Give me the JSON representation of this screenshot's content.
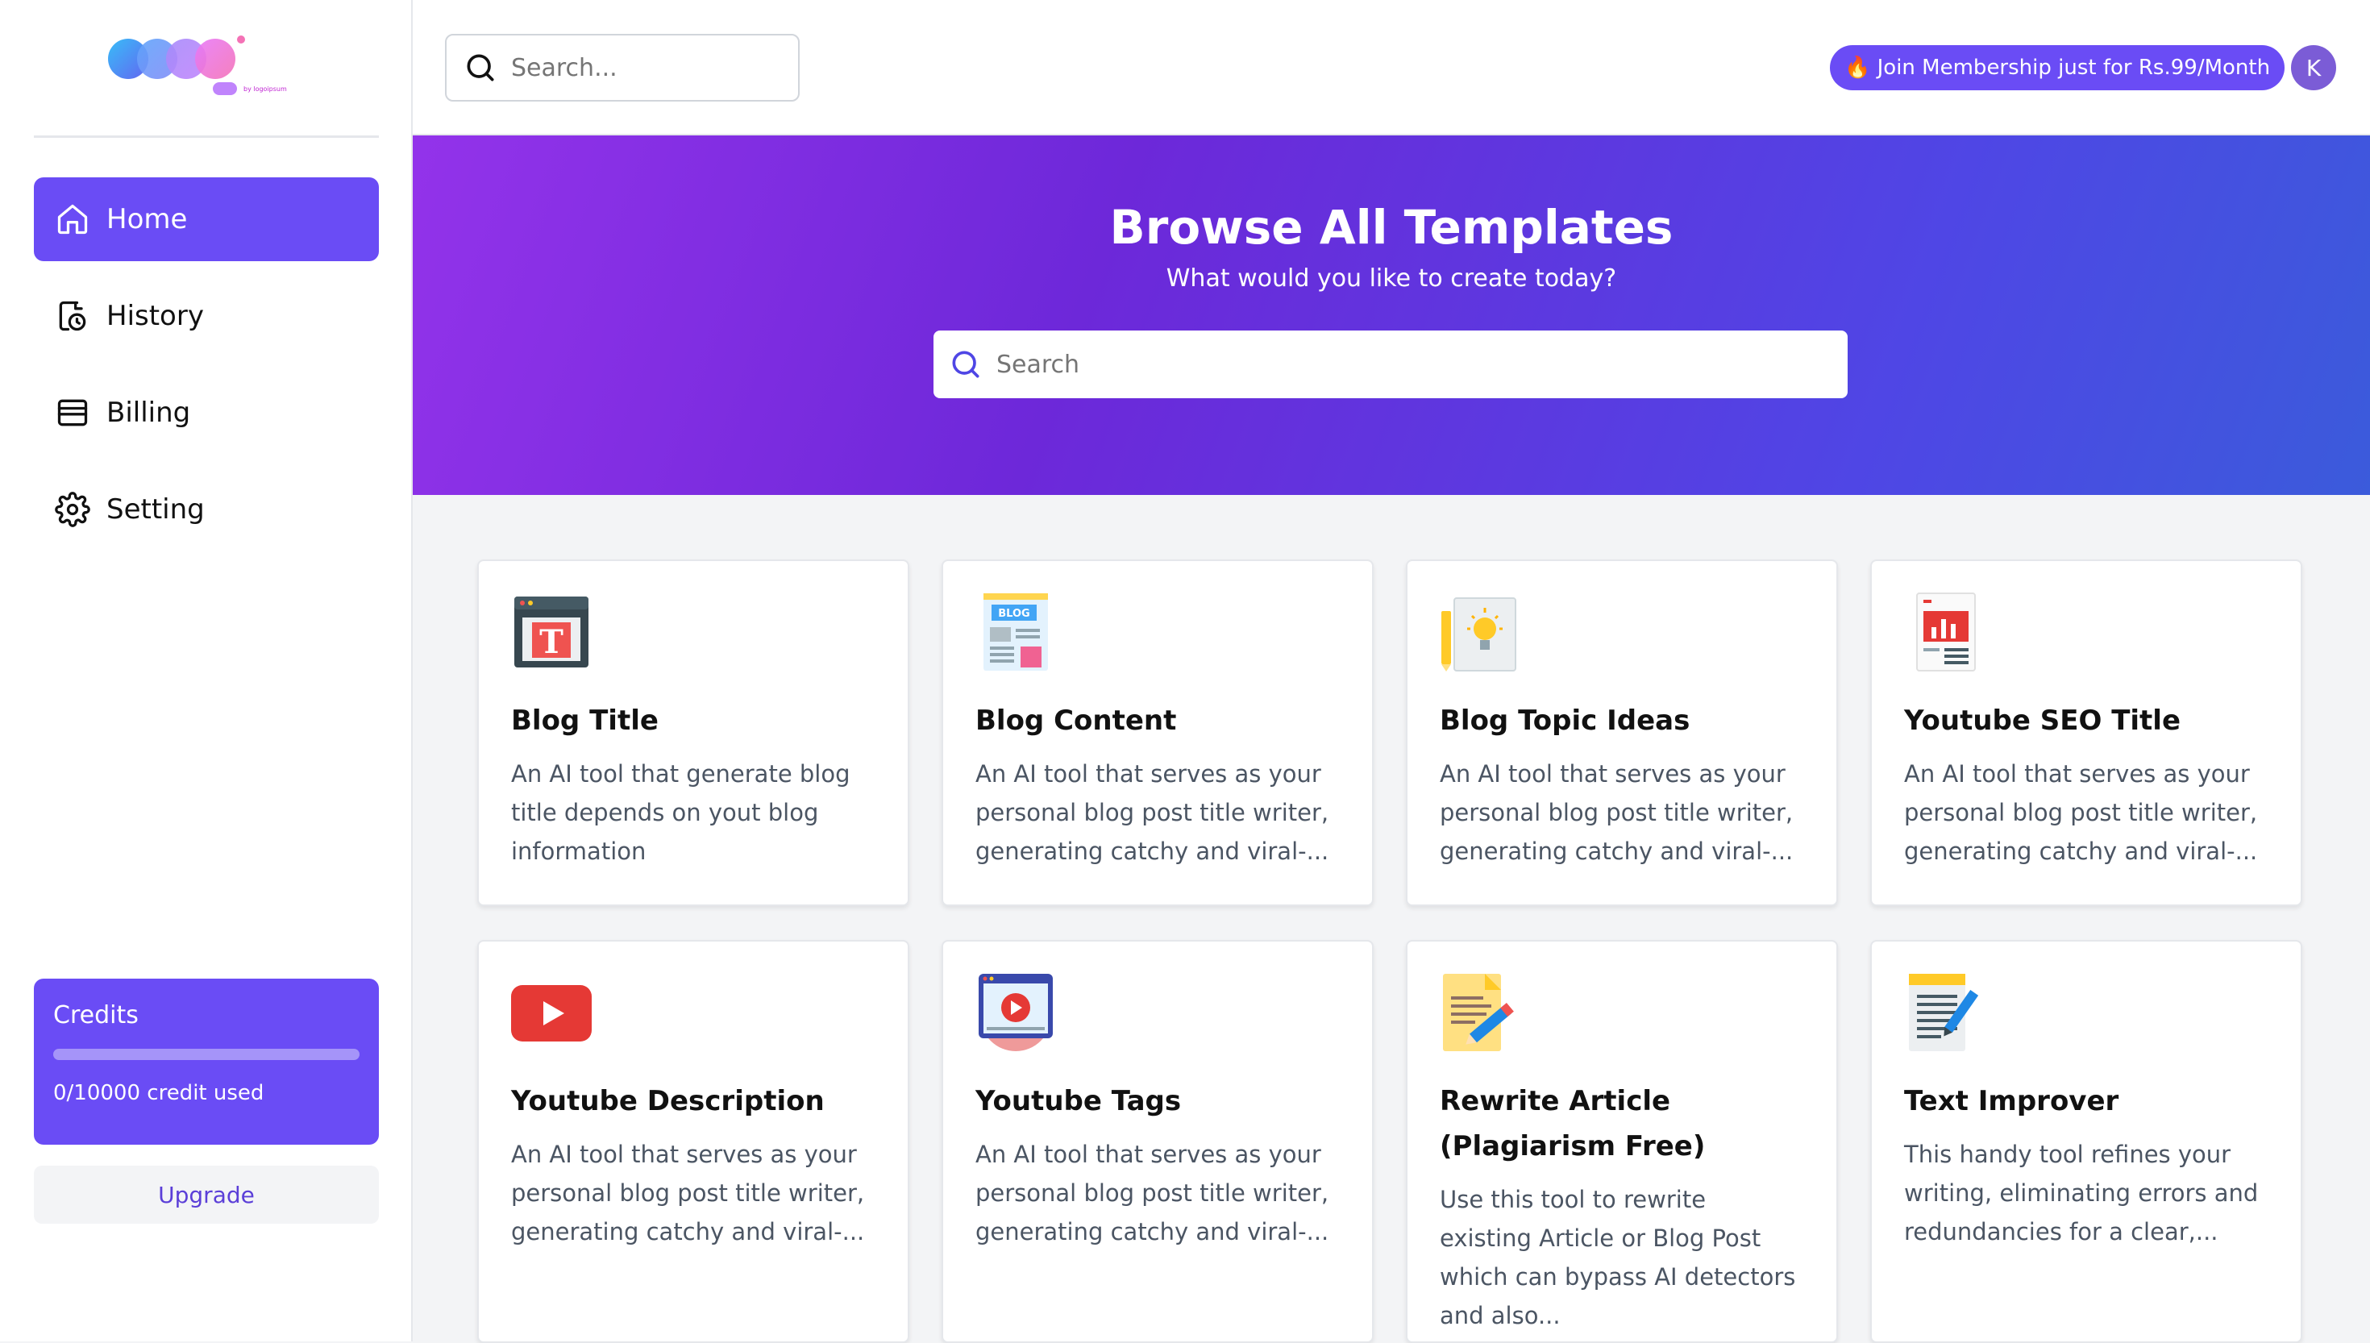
{
  "brand": {
    "logo_text": "Logo",
    "logo_sub": "by logoipsum"
  },
  "sidebar": {
    "items": [
      {
        "label": "Home",
        "icon": "home-icon",
        "active": true
      },
      {
        "label": "History",
        "icon": "history-icon",
        "active": false
      },
      {
        "label": "Billing",
        "icon": "billing-icon",
        "active": false
      },
      {
        "label": "Setting",
        "icon": "gear-icon",
        "active": false
      }
    ],
    "credits": {
      "title": "Credits",
      "used_text": "0/10000 credit used",
      "used_fraction": 0
    },
    "upgrade_label": "Upgrade"
  },
  "topbar": {
    "search_placeholder": "Search...",
    "membership_label": "🔥 Join Membership just for Rs.99/Month",
    "avatar_initial": "K"
  },
  "hero": {
    "title": "Browse All Templates",
    "subtitle": "What would you like to create today?",
    "search_placeholder": "Search"
  },
  "templates": [
    {
      "title": "Blog Title",
      "desc": "An AI tool that generate blog title depends on yout blog information",
      "icon": "blog-title-icon"
    },
    {
      "title": "Blog Content",
      "desc": "An AI tool that serves as your personal blog post title writer, generating catchy and viral-...",
      "icon": "blog-content-icon"
    },
    {
      "title": "Blog Topic Ideas",
      "desc": "An AI tool that serves as your personal blog post title writer, generating catchy and viral-...",
      "icon": "idea-icon"
    },
    {
      "title": "Youtube SEO Title",
      "desc": "An AI tool that serves as your personal blog post title writer, generating catchy and viral-...",
      "icon": "seo-report-icon"
    },
    {
      "title": "Youtube Description",
      "desc": "An AI tool that serves as your personal blog post title writer, generating catchy and viral-...",
      "icon": "youtube-icon"
    },
    {
      "title": "Youtube Tags",
      "desc": "An AI tool that serves as your personal blog post title writer, generating catchy and viral-...",
      "icon": "video-player-icon"
    },
    {
      "title": "Rewrite Article (Plagiarism Free)",
      "desc": "Use this tool to rewrite existing Article or Blog Post which can bypass AI detectors and also...",
      "icon": "rewrite-icon"
    },
    {
      "title": "Text Improver",
      "desc": "This handy tool refines your writing, eliminating errors and redundancies for a clear,...",
      "icon": "notepad-icon"
    }
  ]
}
